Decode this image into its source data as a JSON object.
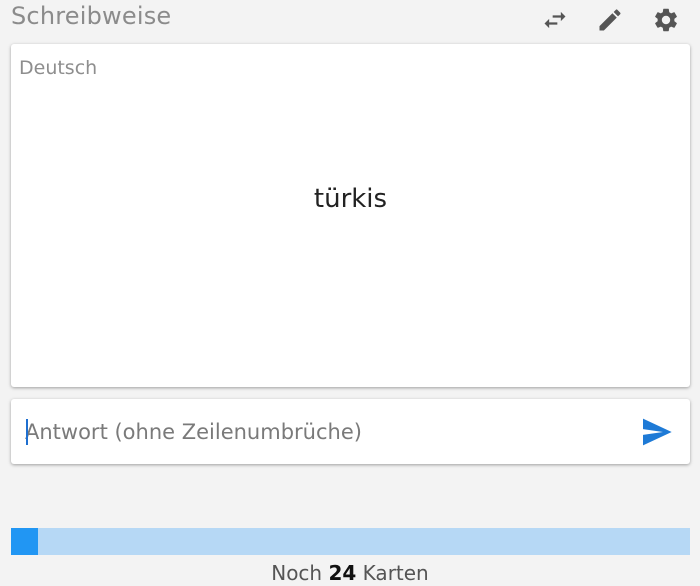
{
  "header": {
    "title": "Schreibweise",
    "icons": [
      "swap-direction-icon",
      "edit-pencil-icon",
      "settings-gear-icon"
    ]
  },
  "card": {
    "language": "Deutsch",
    "word": "türkis"
  },
  "answer": {
    "placeholder": "Antwort (ohne Zeilenumbrüche)",
    "value": "",
    "send_icon": "send-arrow-icon"
  },
  "progress": {
    "fraction_done": 0.04,
    "prefix": "Noch",
    "count": "24",
    "suffix": "Karten"
  },
  "colors": {
    "accent": "#2196f3",
    "progress_track": "#b6d8f5",
    "send_icon": "#1e7ad6",
    "header_icons": "#555555"
  }
}
